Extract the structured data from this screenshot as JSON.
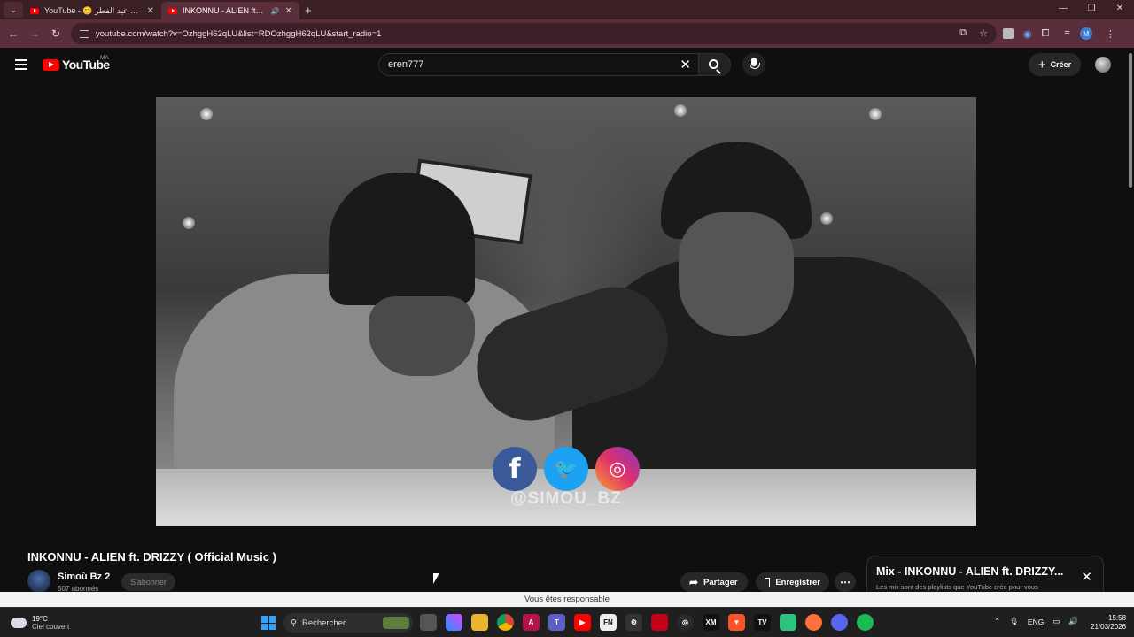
{
  "browser": {
    "tabs": [
      {
        "label": "YouTube - 😊 اجواء عيد الفطر",
        "active": false
      },
      {
        "label": "INKONNU - ALIEN ft. DRIZZY",
        "active": true
      }
    ],
    "url": "youtube.com/watch?v=OzhggH62qLU&list=RDOzhggH62qLU&start_radio=1",
    "profile_initial": "M"
  },
  "masthead": {
    "logo": "YouTube",
    "country": "MA",
    "search_value": "eren777",
    "create_label": "Créer"
  },
  "video": {
    "title": "INKONNU - ALIEN ft. DRIZZY ( Official Music )",
    "overlay_handle": "@SIMOU_BZ",
    "social_icons": [
      "facebook-icon",
      "twitter-icon",
      "instagram-icon"
    ]
  },
  "channel": {
    "name": "Simoù Bz 2",
    "subscribers": "507 abonnés",
    "subscribe_label": "S'abonner"
  },
  "actions": {
    "share_label": "Partager",
    "save_label": "Enregistrer",
    "more_label": "⋯"
  },
  "mix": {
    "title": "Mix - INKONNU - ALIEN ft. DRIZZY...",
    "subtitle": "Les mix sont des playlists que YouTube crée pour vous"
  },
  "notice": "Vous êtes responsable",
  "taskbar": {
    "temperature": "19°C",
    "weather": "Ciel couvert",
    "search_label": "Rechercher",
    "language": "ENG",
    "time": "15:58",
    "date": "21/03/2026"
  }
}
